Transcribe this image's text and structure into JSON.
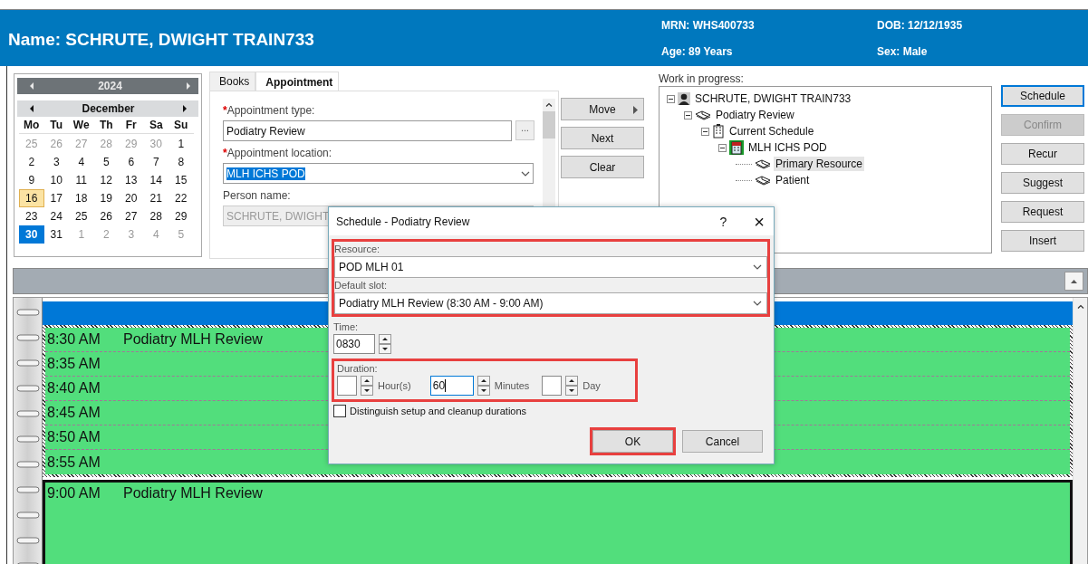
{
  "header": {
    "name": "Name: SCHRUTE, DWIGHT TRAIN733",
    "info": [
      {
        "label": "MRN: WHS400733"
      },
      {
        "label": "DOB: 12/12/1935"
      },
      {
        "label": "Age:  89 Years"
      },
      {
        "label": "Sex: Male"
      }
    ]
  },
  "calendar": {
    "year": "2024",
    "month": "December",
    "weekdays": [
      "Mo",
      "Tu",
      "We",
      "Th",
      "Fr",
      "Sa",
      "Su"
    ],
    "weeks": [
      [
        {
          "day": "25",
          "other_month": true,
          "today": false,
          "selected": false
        },
        {
          "day": "26",
          "other_month": true,
          "today": false,
          "selected": false
        },
        {
          "day": "27",
          "other_month": true,
          "today": false,
          "selected": false
        },
        {
          "day": "28",
          "other_month": true,
          "today": false,
          "selected": false
        },
        {
          "day": "29",
          "other_month": true,
          "today": false,
          "selected": false
        },
        {
          "day": "30",
          "other_month": true,
          "today": false,
          "selected": false
        },
        {
          "day": "1",
          "other_month": false,
          "today": false,
          "selected": false
        }
      ],
      [
        {
          "day": "2",
          "other_month": false,
          "today": false,
          "selected": false
        },
        {
          "day": "3",
          "other_month": false,
          "today": false,
          "selected": false
        },
        {
          "day": "4",
          "other_month": false,
          "today": false,
          "selected": false
        },
        {
          "day": "5",
          "other_month": false,
          "today": false,
          "selected": false
        },
        {
          "day": "6",
          "other_month": false,
          "today": false,
          "selected": false
        },
        {
          "day": "7",
          "other_month": false,
          "today": false,
          "selected": false
        },
        {
          "day": "8",
          "other_month": false,
          "today": false,
          "selected": false
        }
      ],
      [
        {
          "day": "9",
          "other_month": false,
          "today": false,
          "selected": false
        },
        {
          "day": "10",
          "other_month": false,
          "today": false,
          "selected": false
        },
        {
          "day": "11",
          "other_month": false,
          "today": false,
          "selected": false
        },
        {
          "day": "12",
          "other_month": false,
          "today": false,
          "selected": false
        },
        {
          "day": "13",
          "other_month": false,
          "today": false,
          "selected": false
        },
        {
          "day": "14",
          "other_month": false,
          "today": false,
          "selected": false
        },
        {
          "day": "15",
          "other_month": false,
          "today": false,
          "selected": false
        }
      ],
      [
        {
          "day": "16",
          "other_month": false,
          "today": true,
          "selected": false
        },
        {
          "day": "17",
          "other_month": false,
          "today": false,
          "selected": false
        },
        {
          "day": "18",
          "other_month": false,
          "today": false,
          "selected": false
        },
        {
          "day": "19",
          "other_month": false,
          "today": false,
          "selected": false
        },
        {
          "day": "20",
          "other_month": false,
          "today": false,
          "selected": false
        },
        {
          "day": "21",
          "other_month": false,
          "today": false,
          "selected": false
        },
        {
          "day": "22",
          "other_month": false,
          "today": false,
          "selected": false
        }
      ],
      [
        {
          "day": "23",
          "other_month": false,
          "today": false,
          "selected": false
        },
        {
          "day": "24",
          "other_month": false,
          "today": false,
          "selected": false
        },
        {
          "day": "25",
          "other_month": false,
          "today": false,
          "selected": false
        },
        {
          "day": "26",
          "other_month": false,
          "today": false,
          "selected": false
        },
        {
          "day": "27",
          "other_month": false,
          "today": false,
          "selected": false
        },
        {
          "day": "28",
          "other_month": false,
          "today": false,
          "selected": false
        },
        {
          "day": "29",
          "other_month": false,
          "today": false,
          "selected": false
        }
      ],
      [
        {
          "day": "30",
          "other_month": false,
          "today": false,
          "selected": true
        },
        {
          "day": "31",
          "other_month": false,
          "today": false,
          "selected": false
        },
        {
          "day": "1",
          "other_month": true,
          "today": false,
          "selected": false
        },
        {
          "day": "2",
          "other_month": true,
          "today": false,
          "selected": false
        },
        {
          "day": "3",
          "other_month": true,
          "today": false,
          "selected": false
        },
        {
          "day": "4",
          "other_month": true,
          "today": false,
          "selected": false
        },
        {
          "day": "5",
          "other_month": true,
          "today": false,
          "selected": false
        }
      ]
    ]
  },
  "tabs": [
    {
      "label": "Books",
      "selected": false
    },
    {
      "label": "Appointment",
      "selected": true
    }
  ],
  "form": {
    "fields": [
      {
        "kind": "lookup",
        "marker": "*",
        "label": "Appointment type:",
        "value": "Podiatry Review",
        "highlighted_value": false
      },
      {
        "kind": "dropdown",
        "marker": "*",
        "label": "Appointment location:",
        "value": "MLH ICHS POD",
        "highlighted_value": true
      },
      {
        "kind": "readonly",
        "label": "Person name:",
        "value": "SCHRUTE, DWIGHT",
        "highlighted_value": false
      }
    ],
    "lookup_button": "..."
  },
  "action_buttons": [
    {
      "label": "Move",
      "submenu": true
    },
    {
      "label": "Next",
      "submenu": false
    },
    {
      "label": "Clear",
      "submenu": false
    }
  ],
  "work_in_progress": {
    "label": "Work in progress:",
    "tree": [
      {
        "kind": "patient",
        "label": "SCHRUTE, DWIGHT TRAIN733",
        "selected": false,
        "expanded": true,
        "children": [
          {
            "kind": "appointment",
            "label": "Podiatry Review",
            "selected": false,
            "expanded": true,
            "children": [
              {
                "kind": "schedule",
                "label": "Current Schedule",
                "selected": false,
                "expanded": true,
                "children": [
                  {
                    "kind": "location",
                    "label": "MLH ICHS POD",
                    "selected": false,
                    "expanded": true,
                    "children": [
                      {
                        "kind": "resource",
                        "label": "Primary Resource",
                        "selected": true
                      },
                      {
                        "kind": "resource",
                        "label": "Patient",
                        "selected": false
                      }
                    ]
                  }
                ]
              }
            ]
          }
        ]
      }
    ]
  },
  "side_buttons": [
    {
      "label": "Schedule",
      "default": true,
      "disabled": false
    },
    {
      "label": "Confirm",
      "default": false,
      "disabled": true
    },
    {
      "label": "Recur",
      "default": false,
      "disabled": false
    },
    {
      "label": "Suggest",
      "default": false,
      "disabled": false
    },
    {
      "label": "Request",
      "default": false,
      "disabled": false
    },
    {
      "label": "Insert",
      "default": false,
      "disabled": false
    }
  ],
  "schedule": {
    "blocks": [
      {
        "selected": true,
        "rows": [
          {
            "time": "8:30 AM",
            "title": "Podiatry MLH Review"
          },
          {
            "time": "8:35 AM"
          },
          {
            "time": "8:40 AM"
          },
          {
            "time": "8:45 AM"
          },
          {
            "time": "8:50 AM"
          },
          {
            "time": "8:55 AM"
          }
        ]
      },
      {
        "selected": false,
        "rows": [
          {
            "time": "9:00 AM",
            "title": "Podiatry MLH Review"
          }
        ]
      }
    ]
  },
  "dialog": {
    "title": "Schedule - Podiatry Review",
    "help": "?",
    "close": "×",
    "resource_group": {
      "highlighted": true,
      "fields": [
        {
          "label": "Resource:",
          "value": "POD MLH 01"
        },
        {
          "label": "Default slot:",
          "value": "Podiatry MLH Review (8:30 AM - 9:00 AM)"
        }
      ]
    },
    "time": {
      "label": "Time:",
      "value": "0830"
    },
    "duration": {
      "highlighted": true,
      "label": "Duration:",
      "spinners": [
        {
          "unit": "Hour(s)",
          "focused": false
        },
        {
          "unit": "Minutes",
          "value": "60",
          "focused": true
        },
        {
          "unit": "Day",
          "focused": false
        }
      ]
    },
    "checkbox": {
      "label": "Distinguish setup and cleanup durations",
      "checked": false
    },
    "buttons": [
      {
        "label": "OK",
        "highlighted": true
      },
      {
        "label": "Cancel",
        "highlighted": false
      }
    ]
  }
}
